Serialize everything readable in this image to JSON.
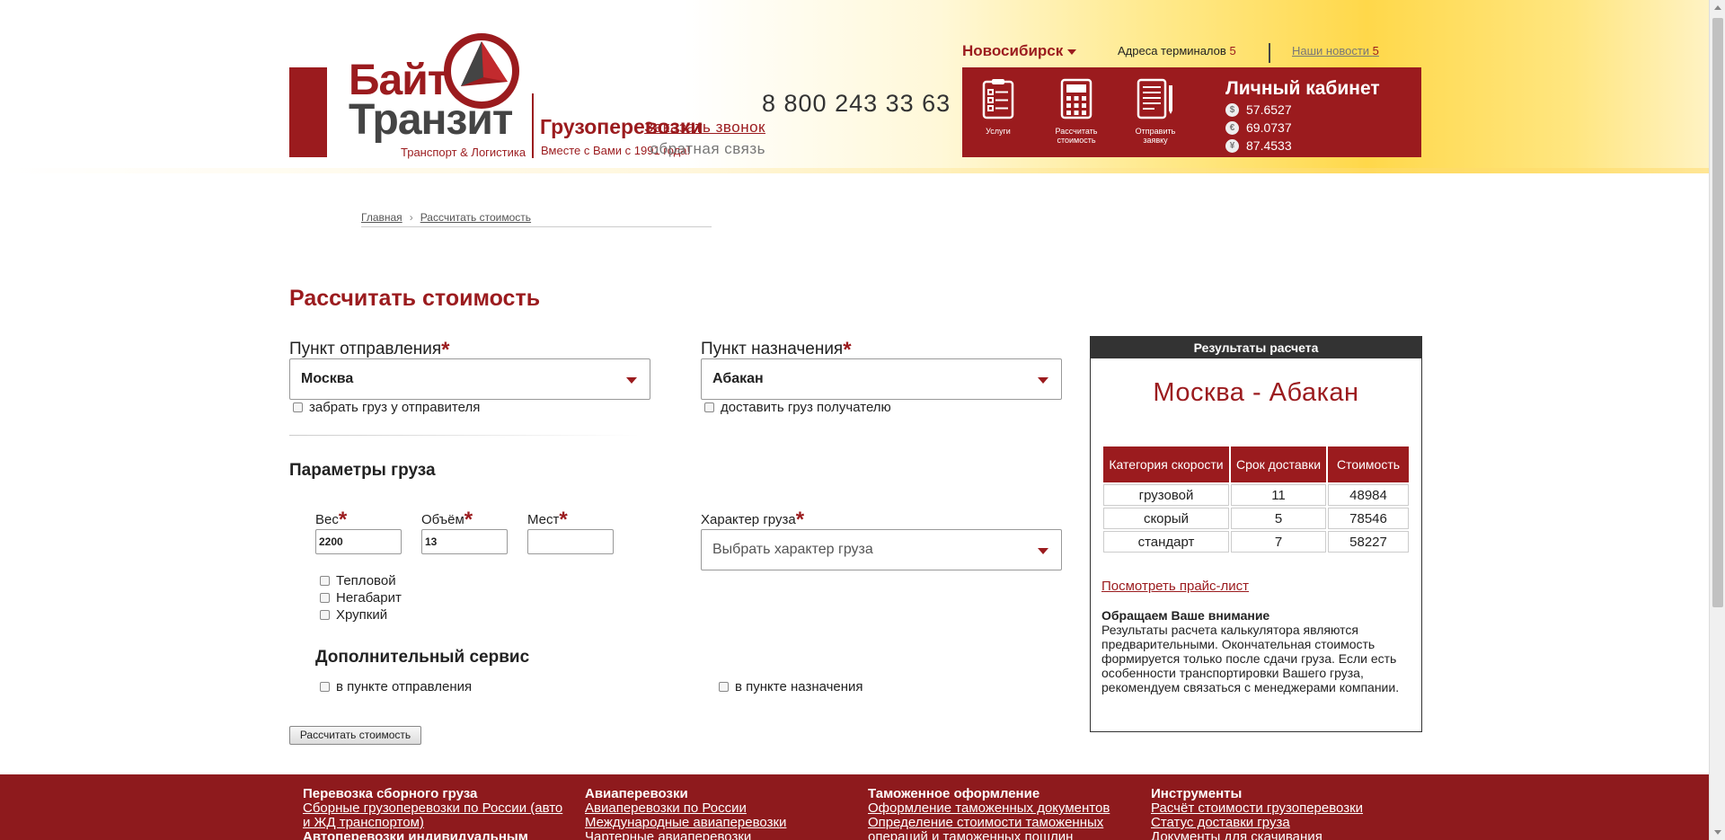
{
  "brand": {
    "name_line1": "Байт",
    "name_line2": "Транзит",
    "tagline": "Транспорт & Логистика",
    "slogan_title": "Грузоперевозки",
    "slogan_sub": "Вместе с Вами с 1991 года!",
    "accent_color": "#9b1b1e"
  },
  "contacts": {
    "phone": "8 800 243 33 63",
    "callback": "Заказать звонок",
    "feedback": "обратная связь"
  },
  "topbar": {
    "city": "Новосибирск",
    "terminals_label": "Адреса терминалов",
    "terminals_count": "5",
    "news_label": "Наши новости",
    "news_count": "5"
  },
  "quicknav": [
    {
      "label": "Услуги",
      "icon": "clipboard-list-icon"
    },
    {
      "label": "Рассчитать стоимость",
      "icon": "calculator-icon"
    },
    {
      "label": "Отправить заявку",
      "icon": "document-pen-icon"
    }
  ],
  "cabinet": {
    "title": "Личный кабинет",
    "rates": [
      {
        "symbol": "$",
        "value": "57.6527",
        "icon": "dollar-icon"
      },
      {
        "symbol": "€",
        "value": "69.0737",
        "icon": "euro-icon"
      },
      {
        "symbol": "¥",
        "value": "87.4533",
        "icon": "yuan-icon"
      }
    ]
  },
  "breadcrumb": {
    "home": "Главная",
    "current": "Рассчитать стоимость"
  },
  "form": {
    "title": "Рассчитать стоимость",
    "origin_label": "Пункт отправления",
    "origin_value": "Москва",
    "origin_check": "забрать груз у отправителя",
    "dest_label": "Пункт назначения",
    "dest_value": "Абакан",
    "dest_check": "доставить груз получателю",
    "params_title": "Параметры груза",
    "weight_label": "Вес",
    "weight_value": "2200",
    "volume_label": "Объём",
    "volume_value": "13",
    "places_label": "Мест",
    "places_value": "",
    "cargo_type_label": "Характер груза",
    "cargo_type_placeholder": "Выбрать характер груза",
    "options": [
      "Тепловой",
      "Негабарит",
      "Хрупкий"
    ],
    "service_title": "Дополнительный сервис",
    "service_origin": "в пункте отправления",
    "service_dest": "в пункте назначения",
    "submit": "Рассчитать стоимость",
    "required_mark": "*"
  },
  "results": {
    "header": "Результаты расчета",
    "route": "Москва - Абакан",
    "columns": [
      "Категория скорости",
      "Срок доставки",
      "Стоимость"
    ],
    "rows": [
      [
        "грузовой",
        "11",
        "48984"
      ],
      [
        "скорый",
        "5",
        "78546"
      ],
      [
        "стандарт",
        "7",
        "58227"
      ]
    ],
    "price_list_link": "Посмотреть прайс-лист",
    "notice_title": "Обращаем Ваше внимание",
    "notice_text": "Результаты расчета калькулятора являются предварительными. Окончательная стоимость формируется только после сдачи груза. Если есть особенности транспортировки Вашего груза, рекомендуем связаться с менеджерами компании."
  },
  "footer": {
    "columns": [
      {
        "title": "Перевозка сборного груза",
        "links": [
          "Сборные грузоперевозки по России (авто и ЖД транспортом)"
        ],
        "extra": "Автоперевозки индивидуальным"
      },
      {
        "title": "Авиаперевозки",
        "links": [
          "Авиаперевозки по России",
          "Международные авиаперевозки",
          "Чартерные авиаперевозки"
        ]
      },
      {
        "title": "Таможенное оформление",
        "links": [
          "Оформление таможенных документов",
          "Определение стоимости таможенных операций и таможенных пошлин"
        ]
      },
      {
        "title": "Инструменты",
        "links": [
          "Расчёт стоимости грузоперевозки",
          "Статус доставки груза",
          "Документы для скачивания"
        ]
      }
    ]
  }
}
